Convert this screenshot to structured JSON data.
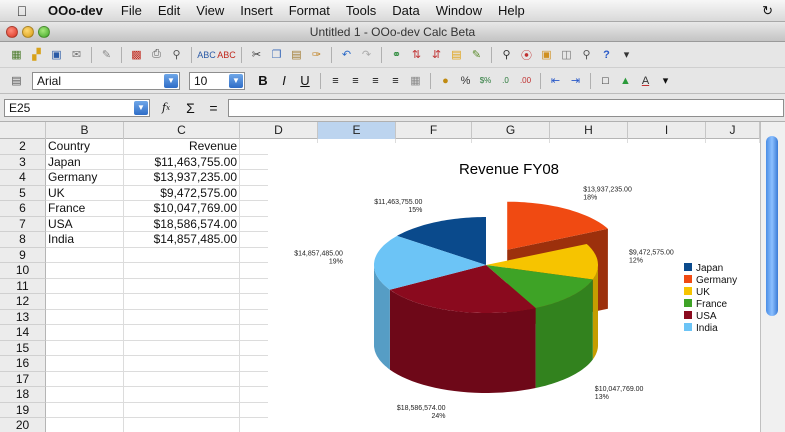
{
  "menubar": {
    "app_name": "OOo-dev",
    "items": [
      "File",
      "Edit",
      "View",
      "Insert",
      "Format",
      "Tools",
      "Data",
      "Window",
      "Help"
    ]
  },
  "window": {
    "title": "Untitled 1 - OOo-dev Calc Beta"
  },
  "formatting": {
    "font_name": "Arial",
    "font_size": "10"
  },
  "formula_bar": {
    "cell_ref": "E25",
    "value": ""
  },
  "grid": {
    "columns": [
      "B",
      "C",
      "D",
      "E",
      "F",
      "G",
      "H",
      "I",
      "J"
    ],
    "active_column": "E",
    "rows": [
      "2",
      "3",
      "4",
      "5",
      "6",
      "7",
      "8",
      "9",
      "10",
      "11",
      "12",
      "13",
      "14",
      "15",
      "16",
      "17",
      "18",
      "19",
      "20"
    ],
    "data": [
      [
        "Country",
        "Revenue"
      ],
      [
        "Japan",
        "$11,463,755.00"
      ],
      [
        "Germany",
        "$13,937,235.00"
      ],
      [
        "UK",
        "$9,472,575.00"
      ],
      [
        "France",
        "$10,047,769.00"
      ],
      [
        "USA",
        "$18,586,574.00"
      ],
      [
        "India",
        "$14,857,485.00"
      ]
    ]
  },
  "chart_data": {
    "type": "pie",
    "title": "Revenue FY08",
    "categories": [
      "Japan",
      "Germany",
      "UK",
      "France",
      "USA",
      "India"
    ],
    "values": [
      11463755,
      13937235,
      9472575,
      10047769,
      18586574,
      14857485
    ],
    "value_labels": [
      "$11,463,755.00",
      "$13,937,235.00",
      "$9,472,575.00",
      "$10,047,769.00",
      "$18,586,574.00",
      "$14,857,485.00"
    ],
    "percent_labels": [
      "15%",
      "18%",
      "12%",
      "13%",
      "24%",
      "19%"
    ],
    "colors": [
      "#0a4a8c",
      "#f04a12",
      "#f6c400",
      "#3ea326",
      "#8a0a1e",
      "#6cc4f6"
    ],
    "exploded": "Germany",
    "legend_position": "right",
    "style": "3d"
  }
}
